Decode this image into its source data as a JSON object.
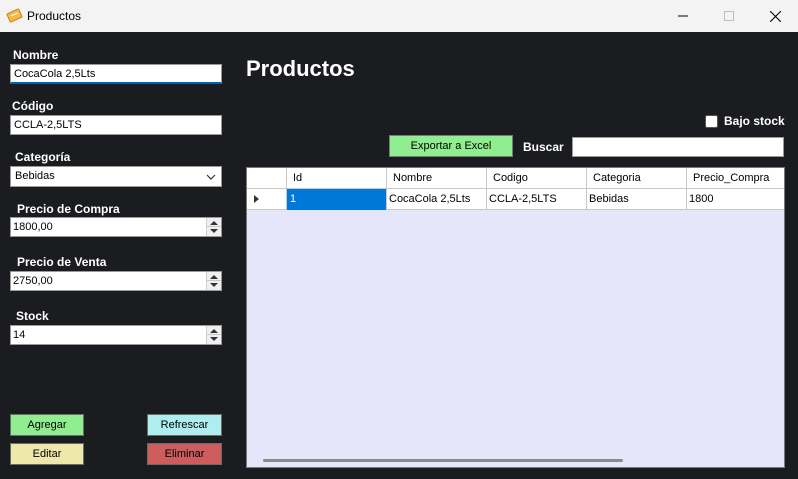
{
  "window": {
    "title": "Productos"
  },
  "form": {
    "nombre_label": "Nombre",
    "nombre_value": "CocaCola 2,5Lts",
    "codigo_label": "Código",
    "codigo_value": "CCLA-2,5LTS",
    "categoria_label": "Categoría",
    "categoria_value": "Bebidas",
    "precio_compra_label": "Precio de Compra",
    "precio_compra_value": "1800,00",
    "precio_venta_label": "Precio de Venta",
    "precio_venta_value": "2750,00",
    "stock_label": "Stock",
    "stock_value": "14"
  },
  "actions": {
    "agregar": "Agregar",
    "refrescar": "Refrescar",
    "editar": "Editar",
    "eliminar": "Eliminar"
  },
  "main": {
    "heading": "Productos",
    "bajo_stock_label": "Bajo stock",
    "exportar_label": "Exportar a Excel",
    "buscar_label": "Buscar",
    "buscar_value": ""
  },
  "grid": {
    "columns": [
      "Id",
      "Nombre",
      "Codigo",
      "Categoria",
      "Precio_Compra"
    ],
    "rows": [
      [
        "1",
        "CocaCola 2,5Lts",
        "CCLA-2,5LTS",
        "Bebidas",
        "1800"
      ]
    ]
  },
  "colors": {
    "background": "#1b1c20",
    "grid_background": "#e6e6fa",
    "agregar": "#90ee90",
    "refrescar": "#aeeeee",
    "editar": "#eee8aa",
    "eliminar": "#cd5c5c",
    "exportar": "#90ee90",
    "selection": "#0078d7"
  },
  "icons": {
    "app": "receipt-icon",
    "minimize": "minimize-icon",
    "maximize": "maximize-icon",
    "close": "close-icon"
  }
}
